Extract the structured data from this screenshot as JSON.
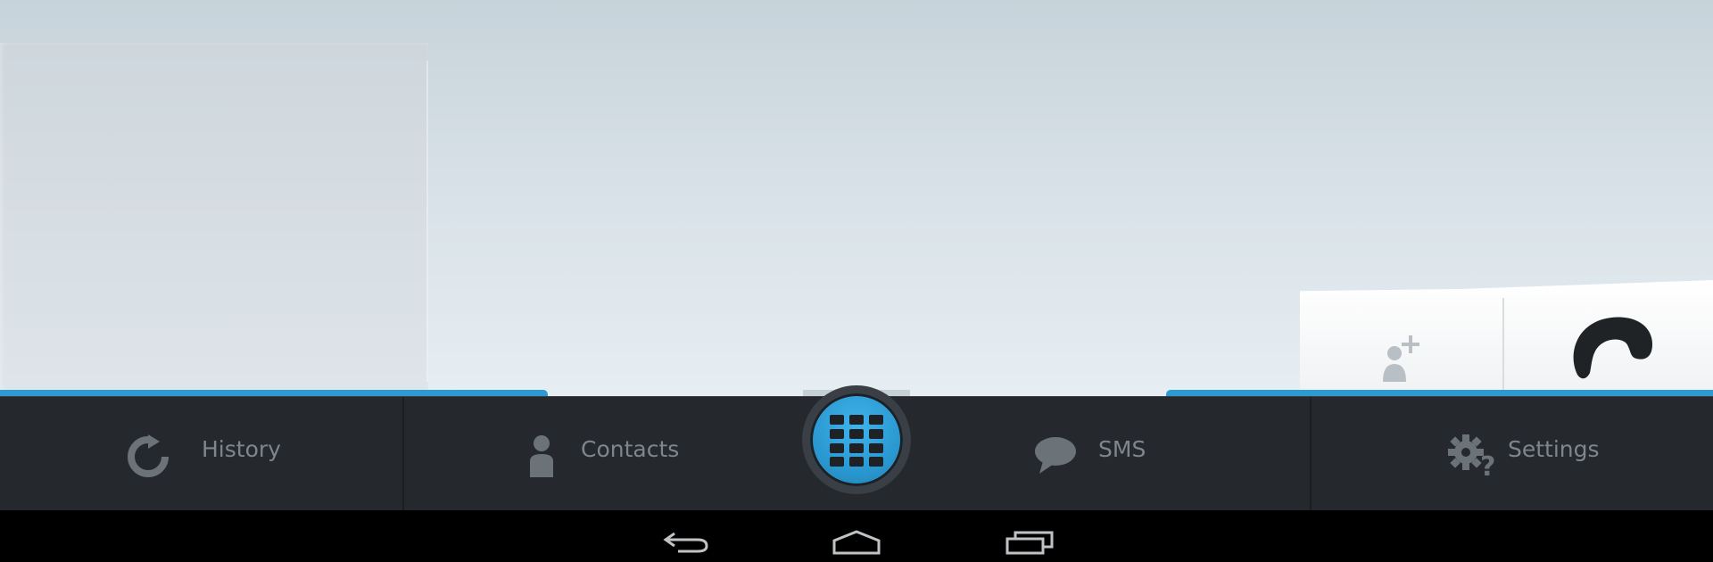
{
  "tabs": {
    "history": {
      "label": "History",
      "icon": "refresh-icon"
    },
    "contacts": {
      "label": "Contacts",
      "icon": "person-icon"
    },
    "dialpad": {
      "icon": "dialpad-icon"
    },
    "sms": {
      "label": "SMS",
      "icon": "chat-bubble-icon"
    },
    "settings": {
      "label": "Settings",
      "icon": "gear-question-icon"
    }
  },
  "actions": {
    "add_contact": {
      "icon": "add-contact-icon"
    },
    "call": {
      "icon": "phone-handset-icon"
    }
  },
  "navbar": {
    "back": {
      "icon": "back-icon"
    },
    "home": {
      "icon": "home-icon"
    },
    "recents": {
      "icon": "recent-apps-icon"
    }
  },
  "colors": {
    "accent": "#2d9ad2",
    "tabbar": "#25282c",
    "tab_text": "#7e868c"
  }
}
